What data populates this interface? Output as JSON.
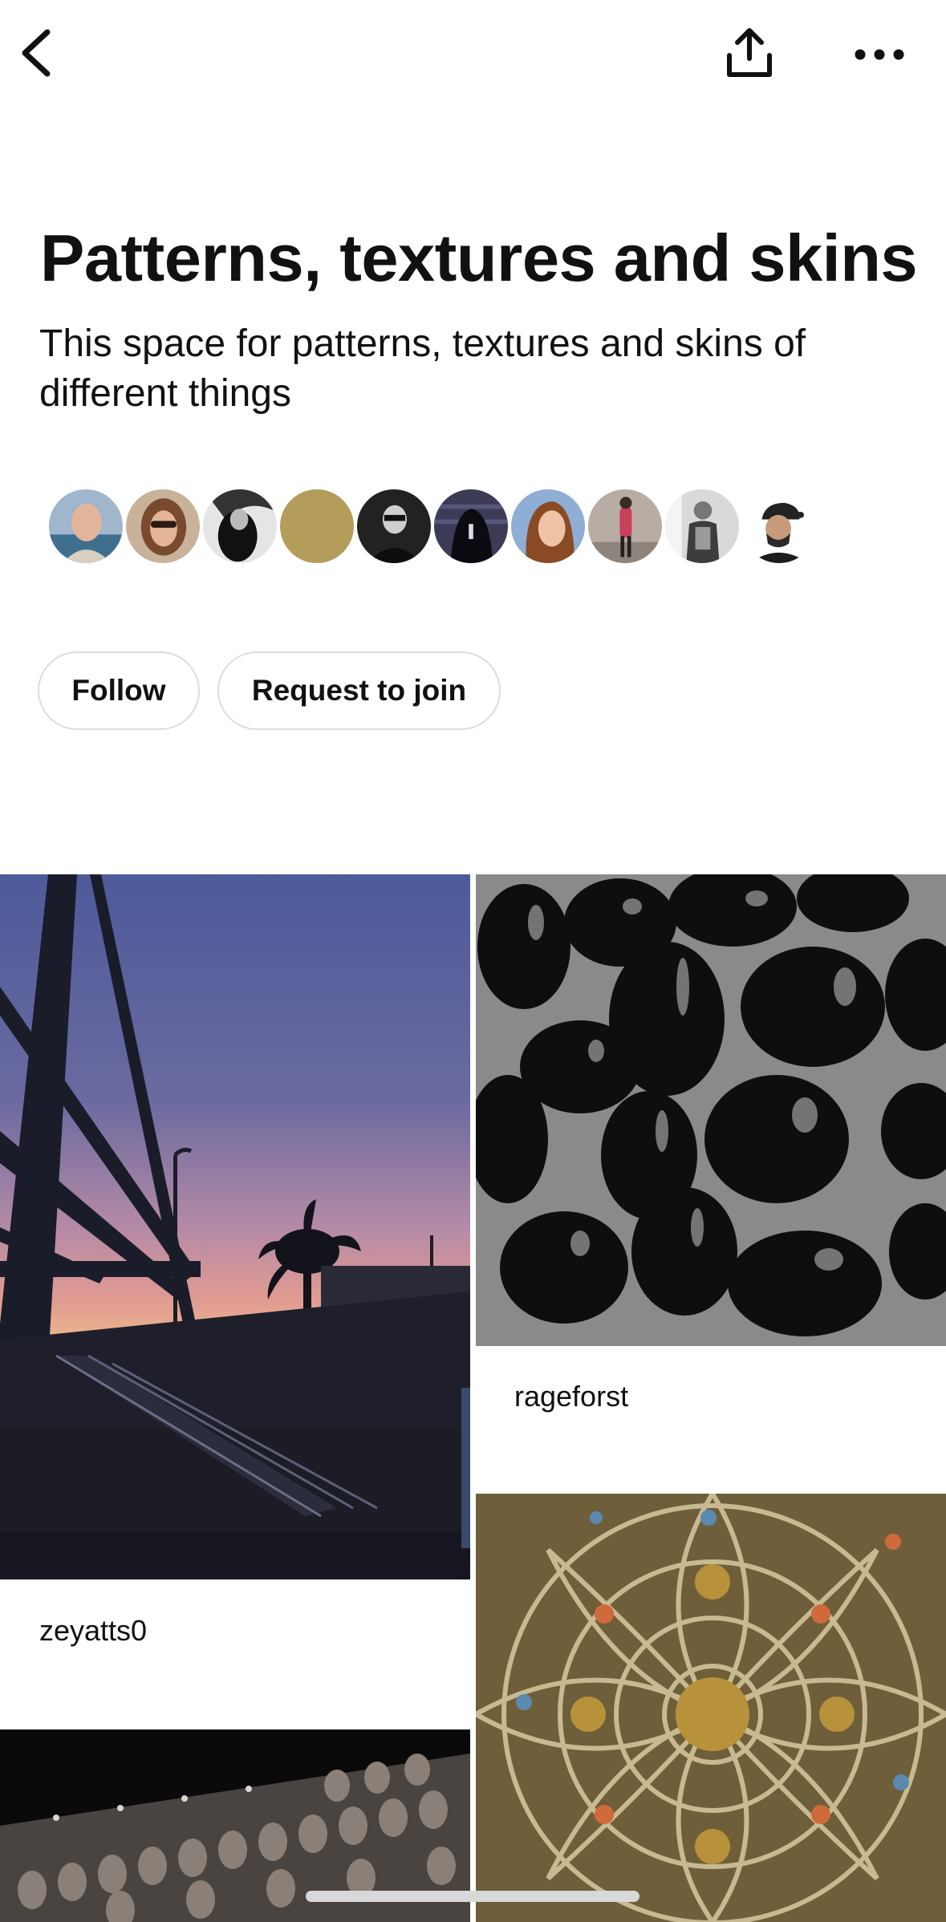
{
  "nav": {
    "back_icon": "chevron-left-icon",
    "share_icon": "share-upload-icon",
    "more_icon": "more-horizontal-icon"
  },
  "board": {
    "title": "Patterns, textures and skins",
    "description": "This space for patterns, textures and skins of different things"
  },
  "members": {
    "count_shown": 10
  },
  "actions": {
    "follow_label": "Follow",
    "join_label": "Request to join"
  },
  "pins": [
    {
      "author": "zeyatts0",
      "subject": "crane silhouette at sunset"
    },
    {
      "author": "rageforst",
      "subject": "black glossy eggs"
    },
    {
      "author": "",
      "subject": "ornate ceiling"
    },
    {
      "author": "",
      "subject": "wall of carved heads"
    }
  ],
  "colors": {
    "text": "#111111",
    "pill_border": "#dcdcdc",
    "background": "#ffffff"
  }
}
